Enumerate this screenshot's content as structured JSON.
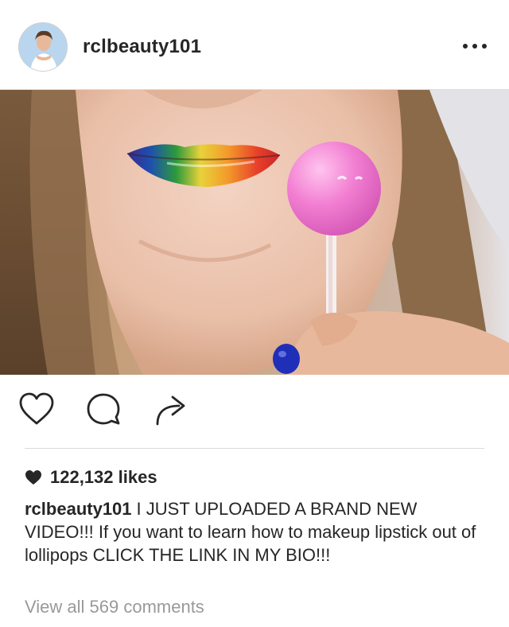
{
  "post": {
    "username": "rclbeauty101",
    "more_icon": "more-horizontal-icon",
    "likes": "122,132 likes",
    "caption_user": "rclbeauty101",
    "caption_text": "I JUST UPLOADED A BRAND NEW VIDEO!!! If you want to learn how to makeup lipstick out of lollipops CLICK THE LINK IN MY BIO!!!",
    "view_comments": "View all 569 comments"
  },
  "actions": {
    "like_icon": "heart-outline-icon",
    "comment_icon": "comment-bubble-icon",
    "share_icon": "share-arrow-icon"
  },
  "colors": {
    "text": "#262626",
    "muted": "#999999",
    "divider": "#dbdbdb",
    "lollipop": "#f07fd0",
    "nail_polish": "#1f2fb8"
  }
}
